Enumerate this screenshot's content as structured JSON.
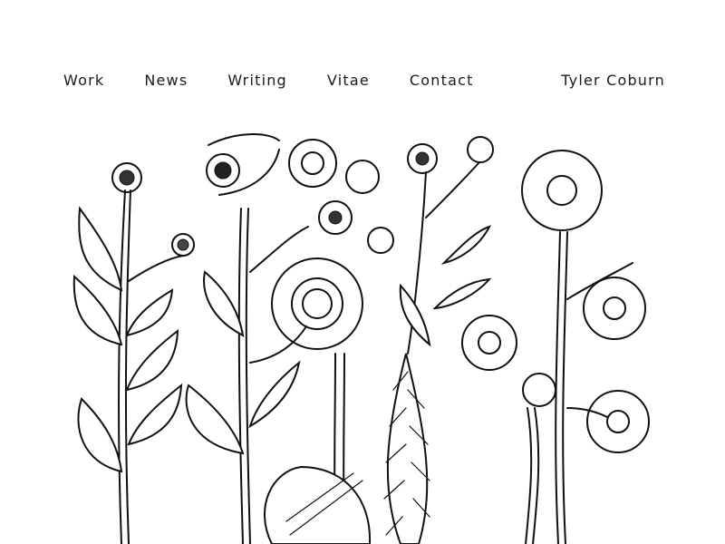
{
  "nav": {
    "items": [
      {
        "label": "Work"
      },
      {
        "label": "News"
      },
      {
        "label": "Writing"
      },
      {
        "label": "Vitae"
      },
      {
        "label": "Contact"
      }
    ]
  },
  "site": {
    "name": "Tyler Coburn"
  },
  "hero": {
    "image_subject": "woodcut-wildflowers"
  },
  "colors": {
    "background": "#ffffff",
    "text": "#1a1a1a",
    "ink": "#111111"
  }
}
